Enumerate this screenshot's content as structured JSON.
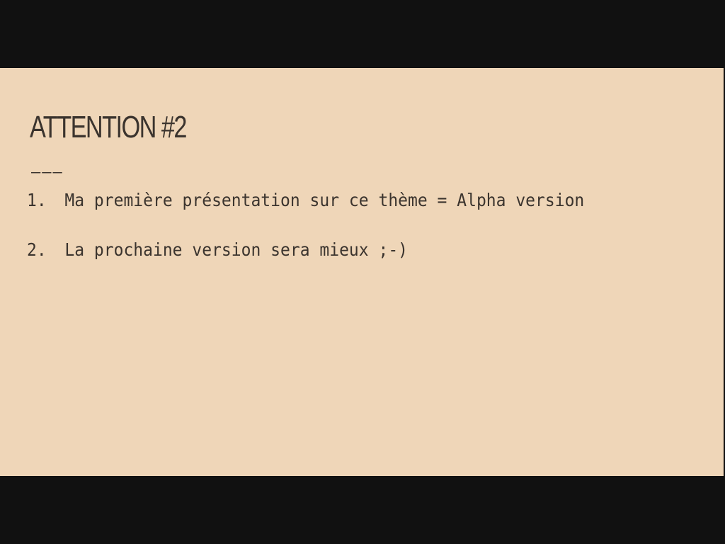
{
  "slide": {
    "title": "ATTENTION #2",
    "rule": "———",
    "items": [
      {
        "number": "1.",
        "text": "Ma première présentation sur ce thème = Alpha version"
      },
      {
        "number": "2.",
        "text": "La prochaine version sera mieux ;-)"
      }
    ]
  },
  "colors": {
    "slide_background": "#efd6b8",
    "text": "#3b342e",
    "letterbox": "#111111"
  }
}
